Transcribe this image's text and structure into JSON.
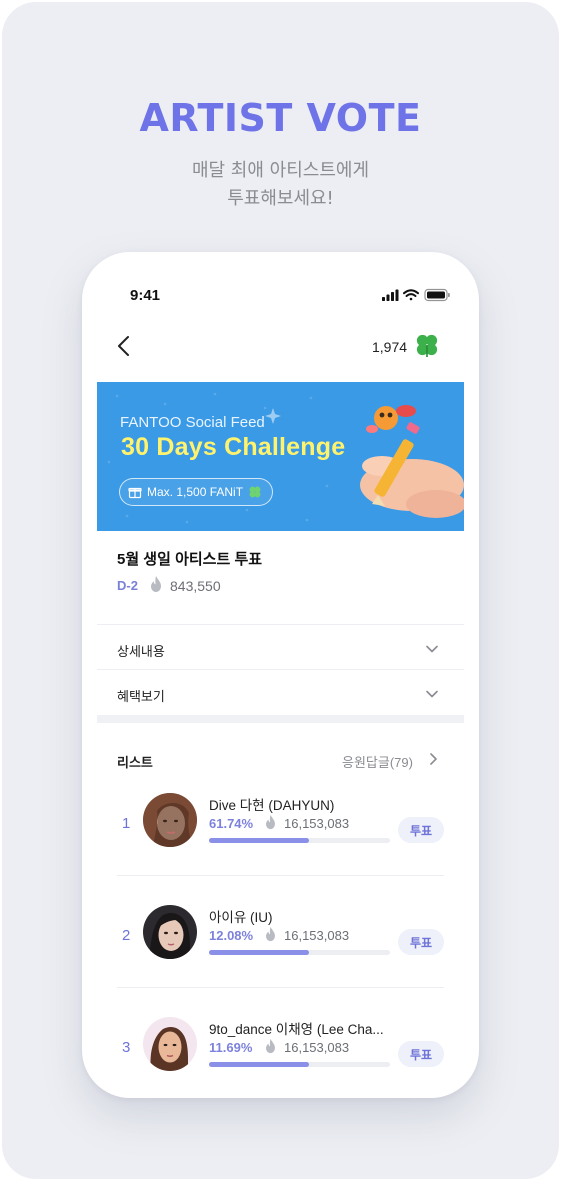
{
  "hero": {
    "title": "ARTIST VOTE",
    "subtitle_line1": "매달 최애 아티스트에게",
    "subtitle_line2": "투표해보세요!"
  },
  "status_bar": {
    "time": "9:41"
  },
  "header": {
    "points": "1,974",
    "points_icon": "clover-icon",
    "back_icon": "chevron-left-icon"
  },
  "banner": {
    "subtitle": "FANTOO Social Feed",
    "title": "30 Days Challenge",
    "reward_label": "Max. 1,500 FANiT",
    "background_color": "#3a9ae6",
    "title_color": "#fff36e"
  },
  "vote": {
    "title": "5월 생일 아티스트 투표",
    "dday": "D-2",
    "total_count": "843,550"
  },
  "sections": {
    "details_label": "상세내용",
    "benefits_label": "혜택보기"
  },
  "list": {
    "label": "리스트",
    "cheer_label": "응원답글(79)",
    "items": [
      {
        "rank": "1",
        "name": "Dive 다현 (DAHYUN)",
        "percent": "61.74%",
        "votes": "16,153,083",
        "fill": 0.55,
        "button": "투표"
      },
      {
        "rank": "2",
        "name": "아이유 (IU)",
        "percent": "12.08%",
        "votes": "16,153,083",
        "fill": 0.55,
        "button": "투표"
      },
      {
        "rank": "3",
        "name": "9to_dance 이채영 (Lee Cha...",
        "percent": "11.69%",
        "votes": "16,153,083",
        "fill": 0.55,
        "button": "투표"
      }
    ]
  },
  "colors": {
    "accent": "#6e73e8",
    "bar": "#8a8fe8",
    "clover": "#3cb04a"
  }
}
